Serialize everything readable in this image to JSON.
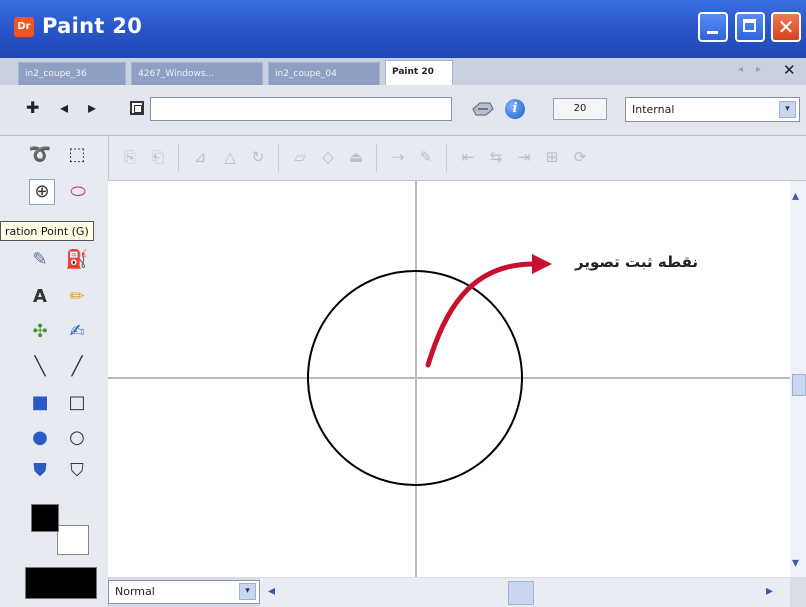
{
  "window": {
    "title": "Paint 20",
    "app_logo": "Dr",
    "accent": "#2a57c9"
  },
  "tabs": [
    {
      "label": "in2_coupe_36"
    },
    {
      "label": "4267_Windows..."
    },
    {
      "label": "in2_coupe_04"
    },
    {
      "label": "Paint 20",
      "active": true
    }
  ],
  "tab_bar": {
    "close_glyph": "✕",
    "prev_glyph": "◂",
    "next_glyph": "▸"
  },
  "property_bar": {
    "back_glyph": "◂",
    "forward_glyph": "▸",
    "add_glyph": "✚",
    "link_value": "",
    "zoom_value": "20",
    "mode_value": "Internal",
    "info_glyph": "i"
  },
  "toolbox": {
    "tooltip": "ration Point (G)",
    "text_tool_glyph": "A"
  },
  "canvas": {
    "annotation_text": "نقطه ثبت تصویر",
    "arrow_color": "#c8102e",
    "circle_color": "#000000"
  },
  "status": {
    "blend_mode": "Normal"
  },
  "icons": {
    "dropdown": "▾",
    "scroll_up": "▴",
    "scroll_down": "▾",
    "scroll_left": "◂",
    "scroll_right": "▸",
    "close_window": "✕"
  }
}
